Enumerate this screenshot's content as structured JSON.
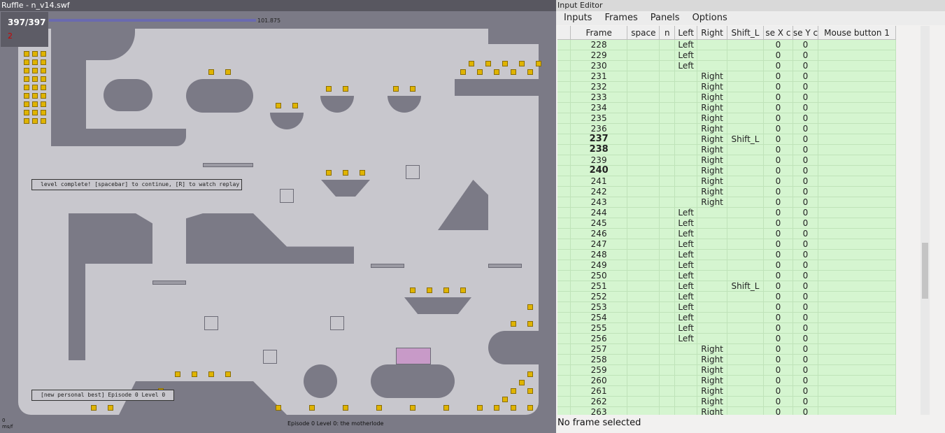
{
  "left_window": {
    "title": "Ruffle - n_v14.swf",
    "hud": {
      "gold_count": "397/397",
      "lives": "2",
      "time": "101.875"
    },
    "level_complete_message": "level complete! [spacebar] to continue, [R] to watch replay",
    "personal_best_message": "[new personal best]  Episode 0 Level 0",
    "level_title": "Episode 0 Level 0: the motherlode",
    "fps_value": "0",
    "fps_unit": "ms/f"
  },
  "right_window": {
    "title": "Input Editor",
    "menu": [
      "Inputs",
      "Frames",
      "Panels",
      "Options"
    ],
    "columns": [
      "Frame",
      "space",
      "n",
      "Left",
      "Right",
      "Shift_L",
      "se X c",
      "se Y c",
      "Mouse button 1"
    ],
    "rows": [
      [
        "228",
        "",
        "",
        "Left",
        "",
        "",
        "0",
        "0",
        ""
      ],
      [
        "229",
        "",
        "",
        "Left",
        "",
        "",
        "0",
        "0",
        ""
      ],
      [
        "230",
        "",
        "",
        "Left",
        "",
        "",
        "0",
        "0",
        ""
      ],
      [
        "231",
        "",
        "",
        "",
        "Right",
        "",
        "0",
        "0",
        ""
      ],
      [
        "232",
        "",
        "",
        "",
        "Right",
        "",
        "0",
        "0",
        ""
      ],
      [
        "233",
        "",
        "",
        "",
        "Right",
        "",
        "0",
        "0",
        ""
      ],
      [
        "234",
        "",
        "",
        "",
        "Right",
        "",
        "0",
        "0",
        ""
      ],
      [
        "235",
        "",
        "",
        "",
        "Right",
        "",
        "0",
        "0",
        ""
      ],
      [
        "236",
        "",
        "",
        "",
        "Right",
        "",
        "0",
        "0",
        ""
      ],
      [
        "237",
        "",
        "",
        "",
        "Right",
        "Shift_L",
        "0",
        "0",
        ""
      ],
      [
        "238",
        "",
        "",
        "",
        "Right",
        "",
        "0",
        "0",
        ""
      ],
      [
        "239",
        "",
        "",
        "",
        "Right",
        "",
        "0",
        "0",
        ""
      ],
      [
        "240",
        "",
        "",
        "",
        "Right",
        "",
        "0",
        "0",
        ""
      ],
      [
        "241",
        "",
        "",
        "",
        "Right",
        "",
        "0",
        "0",
        ""
      ],
      [
        "242",
        "",
        "",
        "",
        "Right",
        "",
        "0",
        "0",
        ""
      ],
      [
        "243",
        "",
        "",
        "",
        "Right",
        "",
        "0",
        "0",
        ""
      ],
      [
        "244",
        "",
        "",
        "Left",
        "",
        "",
        "0",
        "0",
        ""
      ],
      [
        "245",
        "",
        "",
        "Left",
        "",
        "",
        "0",
        "0",
        ""
      ],
      [
        "246",
        "",
        "",
        "Left",
        "",
        "",
        "0",
        "0",
        ""
      ],
      [
        "247",
        "",
        "",
        "Left",
        "",
        "",
        "0",
        "0",
        ""
      ],
      [
        "248",
        "",
        "",
        "Left",
        "",
        "",
        "0",
        "0",
        ""
      ],
      [
        "249",
        "",
        "",
        "Left",
        "",
        "",
        "0",
        "0",
        ""
      ],
      [
        "250",
        "",
        "",
        "Left",
        "",
        "",
        "0",
        "0",
        ""
      ],
      [
        "251",
        "",
        "",
        "Left",
        "",
        "Shift_L",
        "0",
        "0",
        ""
      ],
      [
        "252",
        "",
        "",
        "Left",
        "",
        "",
        "0",
        "0",
        ""
      ],
      [
        "253",
        "",
        "",
        "Left",
        "",
        "",
        "0",
        "0",
        ""
      ],
      [
        "254",
        "",
        "",
        "Left",
        "",
        "",
        "0",
        "0",
        ""
      ],
      [
        "255",
        "",
        "",
        "Left",
        "",
        "",
        "0",
        "0",
        ""
      ],
      [
        "256",
        "",
        "",
        "Left",
        "",
        "",
        "0",
        "0",
        ""
      ],
      [
        "257",
        "",
        "",
        "",
        "Right",
        "",
        "0",
        "0",
        ""
      ],
      [
        "258",
        "",
        "",
        "",
        "Right",
        "",
        "0",
        "0",
        ""
      ],
      [
        "259",
        "",
        "",
        "",
        "Right",
        "",
        "0",
        "0",
        ""
      ],
      [
        "260",
        "",
        "",
        "",
        "Right",
        "",
        "0",
        "0",
        ""
      ],
      [
        "261",
        "",
        "",
        "",
        "Right",
        "",
        "0",
        "0",
        ""
      ],
      [
        "262",
        "",
        "",
        "",
        "Right",
        "",
        "0",
        "0",
        ""
      ],
      [
        "263",
        "",
        "",
        "",
        "Right",
        "",
        "0",
        "0",
        ""
      ]
    ],
    "bold_frames": [
      "237",
      "238",
      "240"
    ],
    "status": "No frame selected"
  },
  "colors": {
    "editor_row": "#d5f5d0",
    "game_wall": "#7b7a86",
    "game_floor": "#c8c7cd",
    "gold": "#e0b400"
  }
}
